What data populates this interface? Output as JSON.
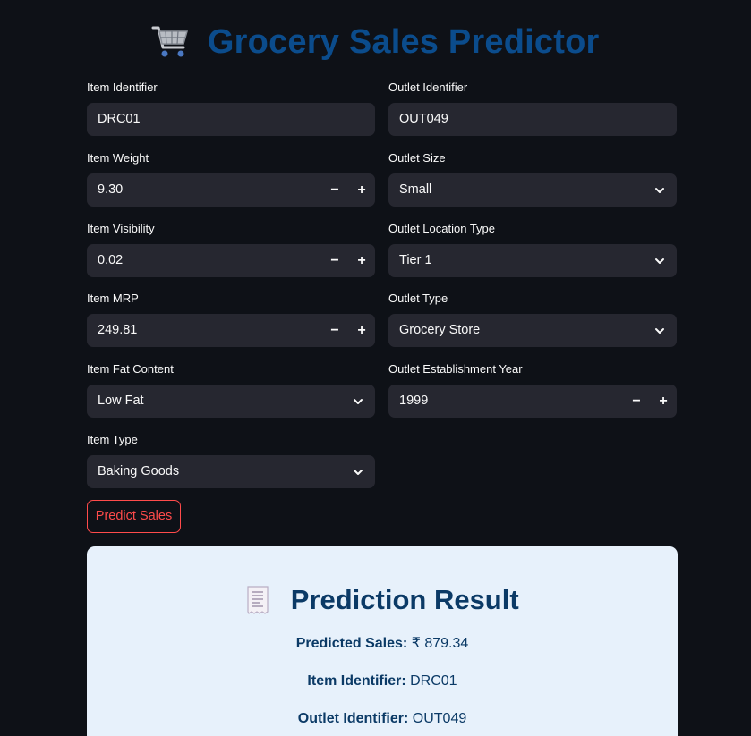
{
  "app": {
    "title": "Grocery Sales Predictor",
    "title_icon": "shopping-cart-icon"
  },
  "form": {
    "item_identifier": {
      "label": "Item Identifier",
      "value": "DRC01"
    },
    "outlet_identifier": {
      "label": "Outlet Identifier",
      "value": "OUT049"
    },
    "item_weight": {
      "label": "Item Weight",
      "value": "9.30",
      "minus": "−",
      "plus": "+"
    },
    "outlet_size": {
      "label": "Outlet Size",
      "value": "Small"
    },
    "item_visibility": {
      "label": "Item Visibility",
      "value": "0.02",
      "minus": "−",
      "plus": "+"
    },
    "outlet_location_type": {
      "label": "Outlet Location Type",
      "value": "Tier 1"
    },
    "item_mrp": {
      "label": "Item MRP",
      "value": "249.81",
      "minus": "−",
      "plus": "+"
    },
    "outlet_type": {
      "label": "Outlet Type",
      "value": "Grocery Store"
    },
    "item_fat_content": {
      "label": "Item Fat Content",
      "value": "Low Fat"
    },
    "outlet_establishment_year": {
      "label": "Outlet Establishment Year",
      "value": "1999",
      "minus": "−",
      "plus": "+"
    },
    "item_type": {
      "label": "Item Type",
      "value": "Baking Goods"
    }
  },
  "actions": {
    "predict_label": "Predict Sales"
  },
  "result": {
    "title": "Prediction Result",
    "title_icon": "receipt-icon",
    "predicted_sales_label": "Predicted Sales:",
    "predicted_sales_value": "₹ 879.34",
    "item_identifier_label": "Item Identifier:",
    "item_identifier_value": "DRC01",
    "outlet_identifier_label": "Outlet Identifier:",
    "outlet_identifier_value": "OUT049"
  },
  "colors": {
    "background": "#0e1117",
    "input_bg": "#262730",
    "title_blue": "#0b4c8c",
    "accent_red": "#ff4b4b",
    "card_bg": "#e7f1fb",
    "card_text": "#0b3a66"
  }
}
